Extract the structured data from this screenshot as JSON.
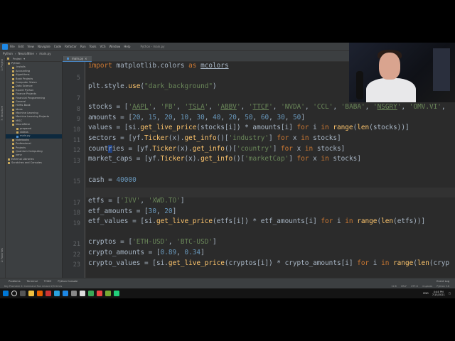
{
  "titlebar": {
    "menu": [
      "File",
      "Edit",
      "View",
      "Navigate",
      "Code",
      "Refactor",
      "Run",
      "Tools",
      "VCS",
      "Window",
      "Help"
    ],
    "window_title": "Python - main.py"
  },
  "navbar": {
    "breadcrumbs": [
      "Python",
      "NeuralNine",
      "main.py"
    ]
  },
  "left_tabs": {
    "project": "1: Project",
    "structure": "7: Structure",
    "favorites": "2: Favorites"
  },
  "project_panel": {
    "header": "Project",
    "items": [
      {
        "label": "Python",
        "type": "folder"
      },
      {
        "label": ".installs",
        "type": "folder"
      },
      {
        "label": "Accounting",
        "type": "folder"
      },
      {
        "label": "Algorithms",
        "type": "folder"
      },
      {
        "label": "Book Projects",
        "type": "folder"
      },
      {
        "label": "Computer Vision",
        "type": "folder"
      },
      {
        "label": "Data Science",
        "type": "folder"
      },
      {
        "label": "Expert Python",
        "type": "folder"
      },
      {
        "label": "Finance Projects",
        "type": "folder"
      },
      {
        "label": "Financial Programming",
        "type": "folder"
      },
      {
        "label": "General",
        "type": "folder"
      },
      {
        "label": "HOML Book",
        "type": "folder"
      },
      {
        "label": "Ideas",
        "type": "folder"
      },
      {
        "label": "Machine Learning",
        "type": "folder"
      },
      {
        "label": "Machine Learning Projects",
        "type": "folder"
      },
      {
        "label": "MISC",
        "type": "folder"
      },
      {
        "label": "NeuralNine",
        "type": "folder"
      },
      {
        "label": "prepared",
        "type": "folder"
      },
      {
        "label": "videos",
        "type": "folder"
      },
      {
        "label": "main.py",
        "type": "file"
      },
      {
        "label": "Notebooks",
        "type": "folder"
      },
      {
        "label": "Professional",
        "type": "folder"
      },
      {
        "label": "Projects",
        "type": "folder"
      },
      {
        "label": "Quantum Computing",
        "type": "folder"
      },
      {
        "label": "venv",
        "type": "folder"
      },
      {
        "label": "External Libraries",
        "type": "folder"
      },
      {
        "label": "Scratches and Consoles",
        "type": "folder"
      }
    ]
  },
  "editor": {
    "tab_label": "main.py",
    "line_numbers": [
      "",
      "5",
      "",
      "7",
      "8",
      "9",
      "10",
      "11",
      "12",
      "13",
      "",
      "15",
      "",
      "17",
      "18",
      "19",
      "",
      "21",
      "22",
      "23"
    ],
    "current_line_index": 9
  },
  "bottom_tools": [
    "Problems",
    "Terminal",
    "TODO",
    "Python Console",
    "Event Log"
  ],
  "statusbar": {
    "message": "Key Promoter X: Command Run missed 2/5 times",
    "position": "12:8",
    "line_sep": "CRLF",
    "encoding": "UTF-8",
    "indent": "4 spaces",
    "interpreter": "Python 3.8"
  },
  "taskbar": {
    "time": "4:44 PM",
    "date": "7/15/2021",
    "lang": "ENG"
  },
  "colors": {
    "ide_bg": "#2b2b2b",
    "panel": "#3c3f41",
    "keyword": "#cc7832",
    "string": "#6a8759",
    "number": "#6897bb"
  }
}
